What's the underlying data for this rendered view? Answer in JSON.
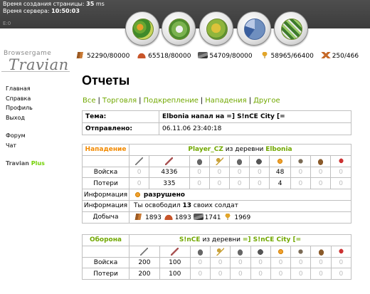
{
  "topbar": {
    "gen_time_label": "Время создания страницы:",
    "gen_time_value": "35",
    "gen_time_unit": "ms",
    "server_time_label": "Время сервера:",
    "server_time_value": "10:50:03",
    "e0": "E:0"
  },
  "nav": [
    "village-overview",
    "village-center",
    "map",
    "statistics",
    "reports"
  ],
  "logo": {
    "small": "Browsergame",
    "main": "Travian"
  },
  "menu": {
    "items": [
      "Главная",
      "Справка",
      "Профиль",
      "Выход"
    ],
    "items2": [
      "Форум",
      "Чат"
    ],
    "plus_word": "Travian",
    "plus_suffix": "Plus"
  },
  "resources": {
    "wood": "52290/80000",
    "clay": "65518/80000",
    "iron": "54709/80000",
    "crop": "58965/66400",
    "food": "250/466"
  },
  "page": {
    "title": "Отчеты",
    "tabs": [
      "Все",
      "Торговля",
      "Подкрепление",
      "Нападения",
      "Другое"
    ]
  },
  "report": {
    "subject_label": "Тема:",
    "subject_value": "Elbonia напал на =] S!nCE City [=",
    "sent_label": "Отправлено:",
    "sent_value": "06.11.06 23:40:18"
  },
  "attack": {
    "role": "Нападение",
    "player": "Player_CZ",
    "from": "из деревни",
    "village": "Elbonia",
    "units_icons": [
      "spear-icon",
      "sword-icon",
      "helmet-icon",
      "key-icon",
      "helmet-icon",
      "horse-icon",
      "gear-icon",
      "catapult-icon",
      "ram-icon",
      "chief-icon"
    ],
    "troops_label": "Войска",
    "troops": [
      "0",
      "4336",
      "0",
      "0",
      "0",
      "0",
      "48",
      "0",
      "0",
      "0"
    ],
    "losses_label": "Потери",
    "losses": [
      "0",
      "335",
      "0",
      "0",
      "0",
      "0",
      "4",
      "0",
      "0",
      "0"
    ],
    "info_label": "Информация",
    "info1": "разрушено",
    "info2_prefix": "Ты освободил",
    "info2_number": "13",
    "info2_suffix": "своих солдат",
    "loot_label": "Добыча",
    "loot": [
      "1893",
      "1893",
      "1741",
      "1969"
    ]
  },
  "defense": {
    "role": "Оборона",
    "player": "S!nCE",
    "from": "из деревни",
    "village": "=] S!nCE City [=",
    "units_icons": [
      "spear-icon",
      "sword-icon",
      "helmet-icon",
      "key-icon",
      "helmet-icon",
      "horse-icon",
      "gear-icon",
      "catapult-icon",
      "ram-icon",
      "chief-icon"
    ],
    "troops_label": "Войска",
    "troops": [
      "200",
      "100",
      "0",
      "0",
      "0",
      "0",
      "0",
      "0",
      "0",
      "0"
    ],
    "losses_label": "Потери",
    "losses": [
      "200",
      "100",
      "0",
      "0",
      "0",
      "0",
      "0",
      "0",
      "0",
      "0"
    ]
  },
  "colors": {
    "green": "#71a800",
    "orange": "#f28a00",
    "topbar": "#444444"
  }
}
